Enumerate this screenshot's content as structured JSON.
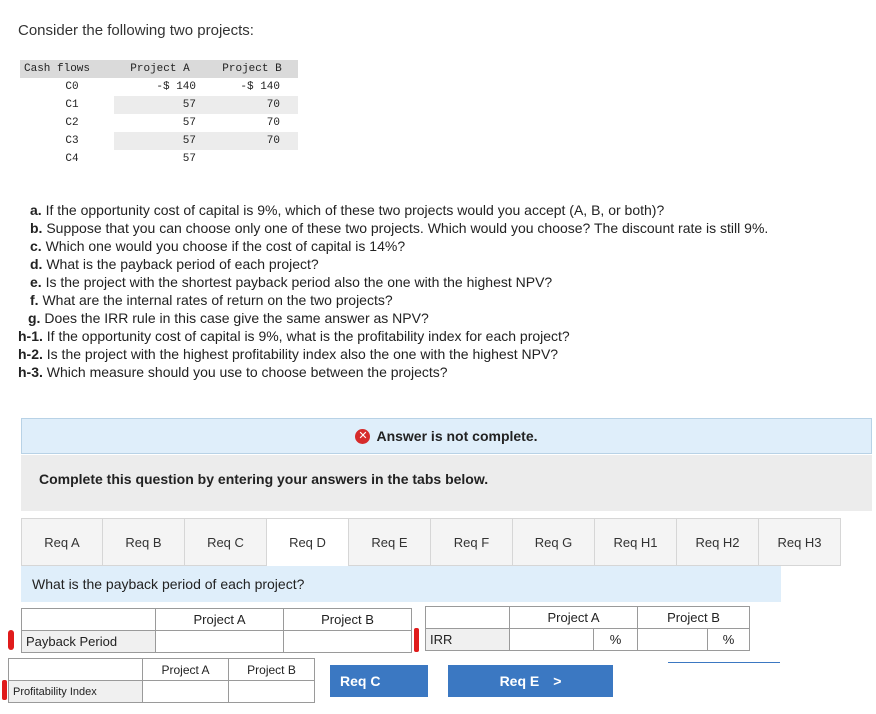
{
  "intro": "Consider the following two projects:",
  "cashflows": {
    "headers": [
      "Cash flows",
      "Project A",
      "Project B"
    ],
    "rows": [
      {
        "label": "C0",
        "a": "-$ 140",
        "b": "-$ 140"
      },
      {
        "label": "C1",
        "a": "57",
        "b": "70"
      },
      {
        "label": "C2",
        "a": "57",
        "b": "70"
      },
      {
        "label": "C3",
        "a": "57",
        "b": "70"
      },
      {
        "label": "C4",
        "a": "57",
        "b": ""
      }
    ]
  },
  "questions": [
    {
      "key": "a.",
      "text": " If the opportunity cost of capital is 9%, which of these two projects would you accept (A, B, or both)?"
    },
    {
      "key": "b.",
      "text": " Suppose that you can choose only one of these two projects. Which would you choose? The discount rate is still 9%."
    },
    {
      "key": "c.",
      "text": " Which one would you choose if the cost of capital is 14%?"
    },
    {
      "key": "d.",
      "text": " What is the payback period of each project?"
    },
    {
      "key": "e.",
      "text": " Is the project with the shortest payback period also the one with the highest NPV?"
    },
    {
      "key": "f.",
      "text": " What are the internal rates of return on the two projects?"
    },
    {
      "key": "g.",
      "text": " Does the IRR rule in this case give the same answer as NPV?"
    },
    {
      "key": "h-1.",
      "text": " If the opportunity cost of capital is 9%, what is the profitability index for each project?"
    },
    {
      "key": "h-2.",
      "text": " Is the project with the highest profitability index also the one with the highest NPV?"
    },
    {
      "key": "h-3.",
      "text": " Which measure should you use to choose between the projects?"
    }
  ],
  "status": "Answer is not complete.",
  "instruction": "Complete this question by entering your answers in the tabs below.",
  "tabs": [
    "Req A",
    "Req B",
    "Req C",
    "Req D",
    "Req E",
    "Req F",
    "Req G",
    "Req H1",
    "Req H2",
    "Req H3"
  ],
  "active_tab": "Req D",
  "prompt": "What is the payback period of each project?",
  "payback": {
    "headers": [
      "Project A",
      "Project B"
    ],
    "row_label": "Payback Period",
    "a": "",
    "b": ""
  },
  "irr": {
    "headers": [
      "Project A",
      "Project B"
    ],
    "row_label": "IRR",
    "unit": "%",
    "a": "",
    "b": ""
  },
  "pi": {
    "headers": [
      "Project A",
      "Project B"
    ],
    "row_label": "Profitability Index",
    "a": "",
    "b": ""
  },
  "nav": {
    "prev": "Req C",
    "next": "Req E",
    "next_arrow": ">"
  },
  "colors": {
    "accent": "#3b78c2",
    "panel": "#dfeefa",
    "error": "#d62b2b"
  }
}
